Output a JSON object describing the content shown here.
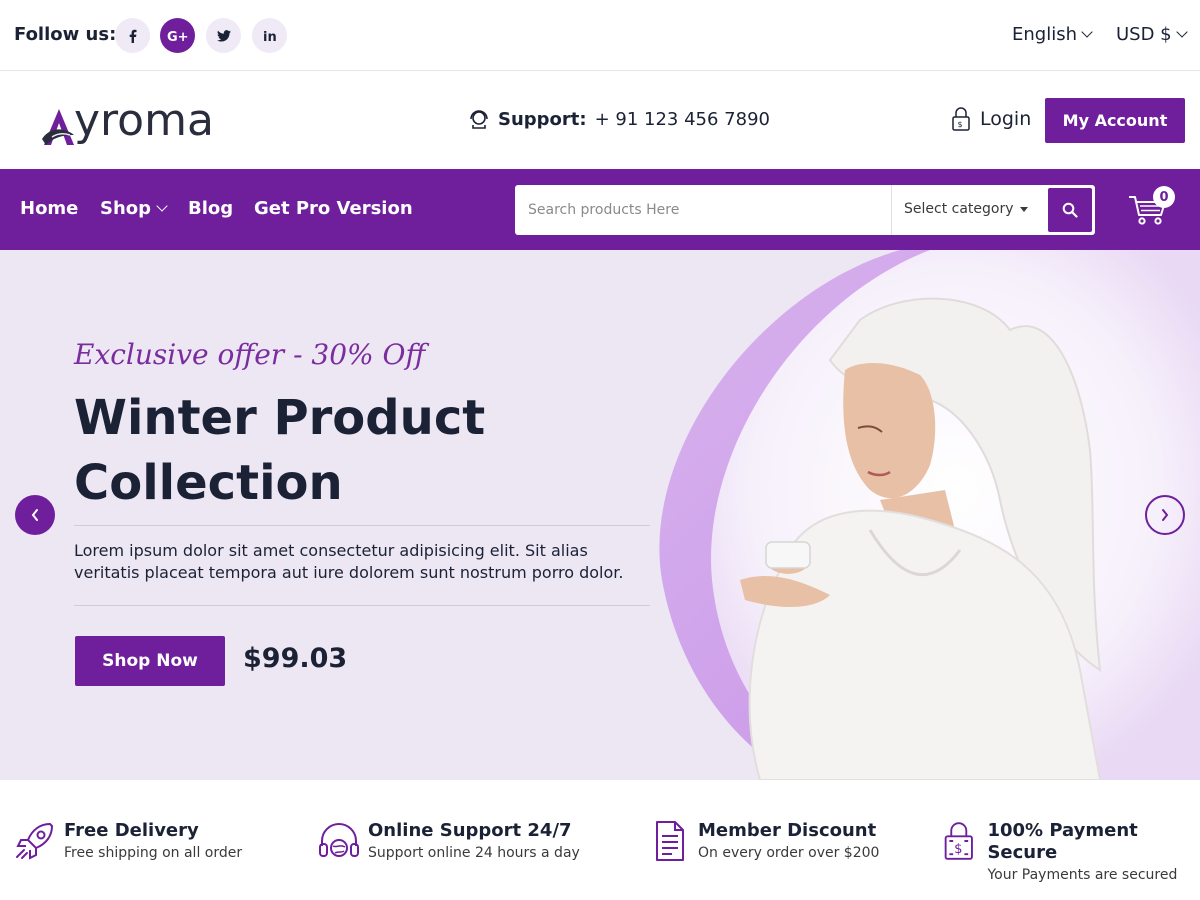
{
  "colors": {
    "accent": "#6f1e9c",
    "hero_bg": "#ede6f3",
    "text_dark": "#1b2236"
  },
  "topbar": {
    "follow_label": "Follow us:",
    "socials": [
      {
        "name": "facebook-icon",
        "glyph": "f"
      },
      {
        "name": "google-plus-icon",
        "glyph": "G+"
      },
      {
        "name": "twitter-icon",
        "glyph": "bird"
      },
      {
        "name": "linkedin-icon",
        "glyph": "in"
      }
    ],
    "language": "English",
    "currency": "USD $"
  },
  "header": {
    "logo_text": "yroma",
    "support_label": "Support:",
    "support_phone": "+ 91 123 456 7890",
    "login_label": "Login",
    "account_label": "My Account"
  },
  "nav": {
    "items": [
      {
        "label": "Home"
      },
      {
        "label": "Shop"
      },
      {
        "label": "Blog"
      },
      {
        "label": "Get Pro Version"
      }
    ],
    "search": {
      "placeholder": "Search products Here",
      "value": "",
      "category": "Select category"
    },
    "cart_count": "0"
  },
  "hero": {
    "offer": "Exclusive offer - 30% Off",
    "title_line1": "Winter Product",
    "title_line2": "Collection",
    "description": "Lorem ipsum dolor sit amet consectetur adipisicing elit. Sit alias veritatis placeat tempora aut iure dolorem sunt nostrum porro dolor.",
    "button": "Shop Now",
    "price": "$99.03"
  },
  "features": [
    {
      "icon": "rocket-icon",
      "title": "Free Delivery",
      "desc": "Free shipping on all order"
    },
    {
      "icon": "headset-icon",
      "title": "Online Support 24/7",
      "desc": "Support online 24 hours a day"
    },
    {
      "icon": "document-icon",
      "title": "Member Discount",
      "desc": "On every order over $200"
    },
    {
      "icon": "secure-lock-icon",
      "title": "100% Payment Secure",
      "desc": "Your Payments are secured"
    }
  ]
}
